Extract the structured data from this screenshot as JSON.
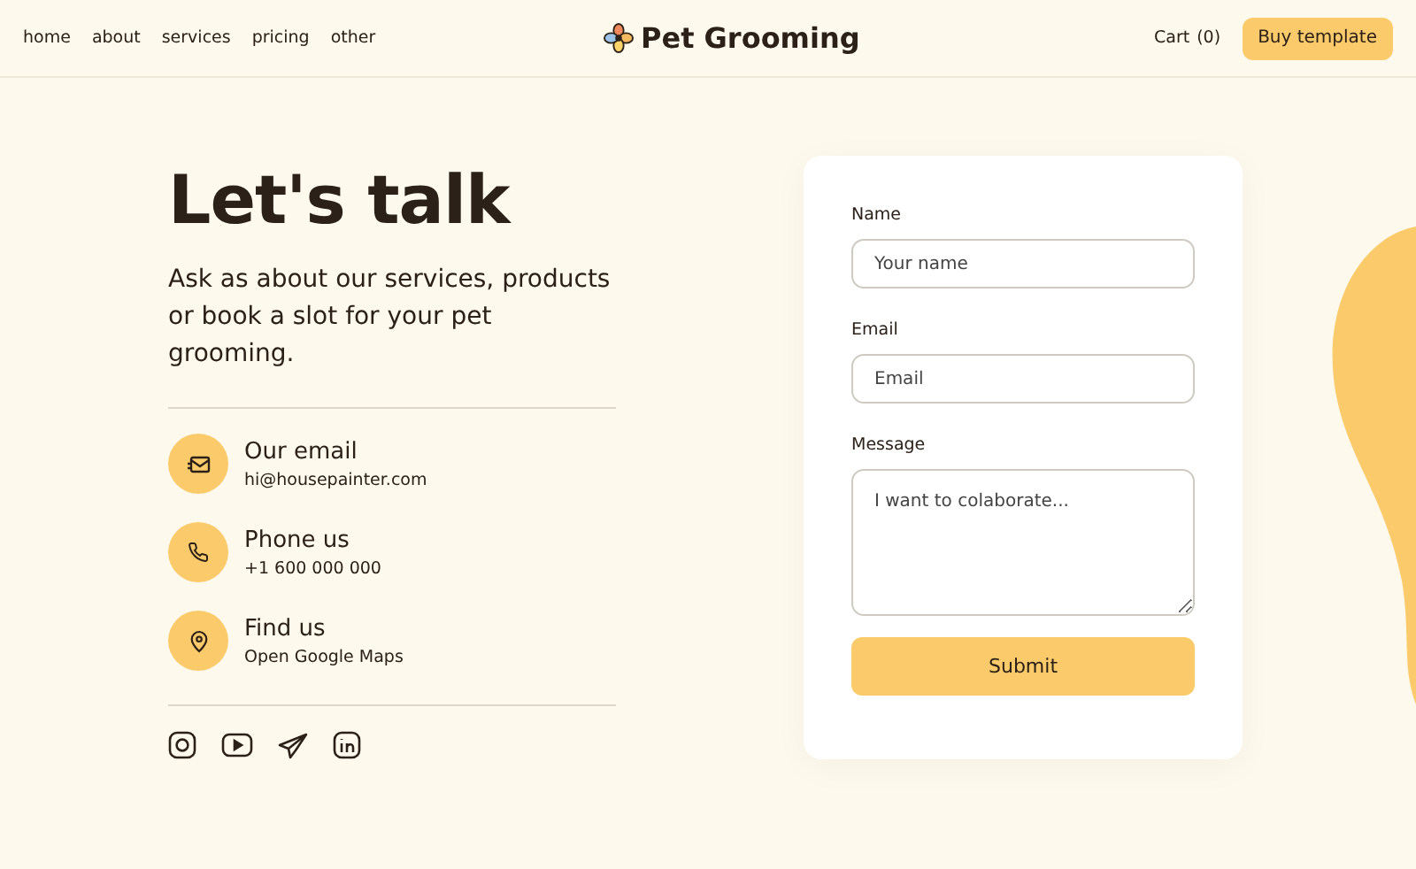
{
  "nav": {
    "links": [
      {
        "label": "home"
      },
      {
        "label": "about"
      },
      {
        "label": "services"
      },
      {
        "label": "pricing"
      },
      {
        "label": "other"
      }
    ],
    "brand": "Pet Grooming",
    "cart": {
      "label": "Cart",
      "count": "(0)"
    },
    "cta": "Buy template"
  },
  "contact": {
    "title": "Let's talk",
    "intro": "Ask as about our services, products or book a slot for your pet grooming.",
    "items": [
      {
        "kind": "email",
        "title": "Our email",
        "detail": "hi@housepainter.com"
      },
      {
        "kind": "phone",
        "title": "Phone us",
        "detail": "+1 600 000 000"
      },
      {
        "kind": "location",
        "title": "Find us",
        "detail": "Open Google Maps"
      }
    ],
    "socials": [
      {
        "kind": "instagram"
      },
      {
        "kind": "youtube"
      },
      {
        "kind": "telegram"
      },
      {
        "kind": "linkedin"
      }
    ]
  },
  "form": {
    "fields": [
      {
        "kind": "input",
        "label": "Name",
        "placeholder": "Your name"
      },
      {
        "kind": "input",
        "label": "Email",
        "placeholder": "Email"
      },
      {
        "kind": "textarea",
        "label": "Message",
        "placeholder": "I want to colaborate..."
      }
    ],
    "submit": "Submit"
  }
}
